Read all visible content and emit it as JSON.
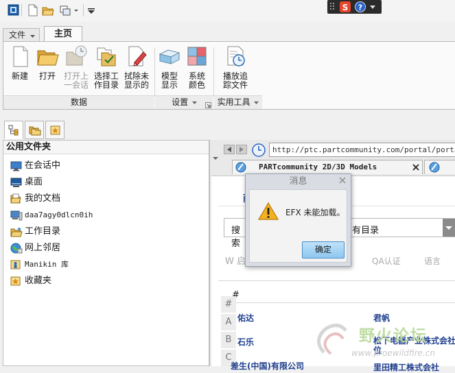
{
  "quick_access": {
    "icons": [
      "app-icon",
      "new-doc-icon",
      "open-folder-icon",
      "window-icon",
      "dropdown-arrow-icon",
      "customize-icon"
    ],
    "ime_icons": [
      "sogou-icon",
      "help-icon"
    ]
  },
  "ribbon": {
    "file_tab": "文件",
    "home_tab": "主页",
    "buttons": {
      "new": "新建",
      "open": "打开",
      "open_session_l1": "打开上",
      "open_session_l2": "一会话",
      "select_dir_l1": "选择工",
      "select_dir_l2": "作目录",
      "erase_l1": "拭除未",
      "erase_l2": "显示的",
      "model_display_l1": "模型",
      "model_display_l2": "显示",
      "system_color_l1": "系统",
      "system_color_l2": "颜色",
      "playback_l1": "播放追",
      "playback_l2": "踪文件"
    },
    "groups": {
      "data": "数据",
      "settings": "设置",
      "utilities": "实用工具"
    }
  },
  "left_panel": {
    "title": "公用文件夹",
    "items": [
      {
        "label": "在会话中",
        "icon": "monitor-icon"
      },
      {
        "label": "桌面",
        "icon": "desktop-icon"
      },
      {
        "label": "我的文档",
        "icon": "documents-icon"
      },
      {
        "label": "daa7agy0dlcn0ih",
        "icon": "computer-icon"
      },
      {
        "label": "工作目录",
        "icon": "working-dir-icon"
      },
      {
        "label": "网上邻居",
        "icon": "network-icon"
      },
      {
        "label": "Manikin 库",
        "icon": "library-icon"
      },
      {
        "label": "收藏夹",
        "icon": "favorites-icon"
      }
    ]
  },
  "browser": {
    "url": "http://ptc.partcommunity.com/portal/portal/pt",
    "tab_title": "PARTcommunity 2D/3D Models",
    "page": {
      "nav_fragment": "雨",
      "search_button": "搜索",
      "search_scope": "有目录",
      "w_fragment": "W 启",
      "qa_link": "QA认证",
      "lang_link": "语言",
      "hash": "#",
      "alpha": [
        "#",
        "A",
        "B",
        "C"
      ],
      "companies_left": [
        "佑达",
        "石乐",
        "差生(中国)有限公司"
      ],
      "companies_right": [
        "君帆",
        "松下电器产业株式会社",
        "位",
        "里田精工株式会社"
      ]
    }
  },
  "dialog": {
    "title": "消息",
    "message": "EFX 未能加载。",
    "ok": "确定"
  },
  "watermark": {
    "text": "野火论坛",
    "url": "www.proewildfire.cn"
  }
}
